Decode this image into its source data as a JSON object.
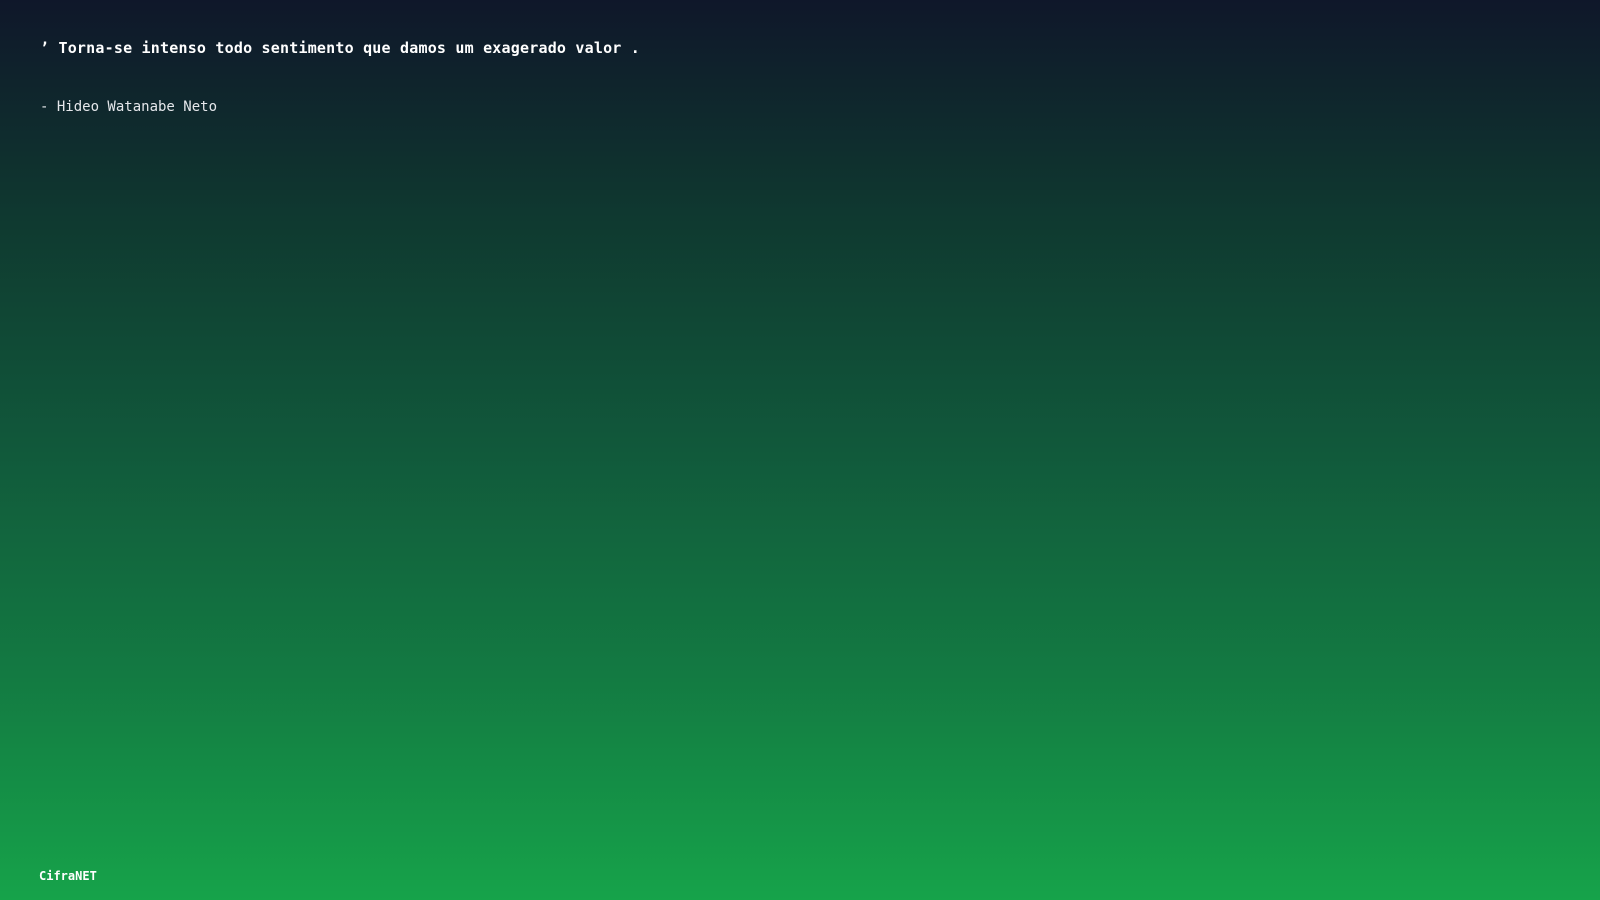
{
  "quote": {
    "text": "’ Torna-se intenso todo sentimento que damos um exagerado valor .",
    "author": "- Hideo Watanabe Neto"
  },
  "brand": {
    "name": "CifraNET"
  },
  "colors": {
    "gradient_top": "#0f172a",
    "gradient_bottom": "#16a34a",
    "text": "#ffffff"
  }
}
